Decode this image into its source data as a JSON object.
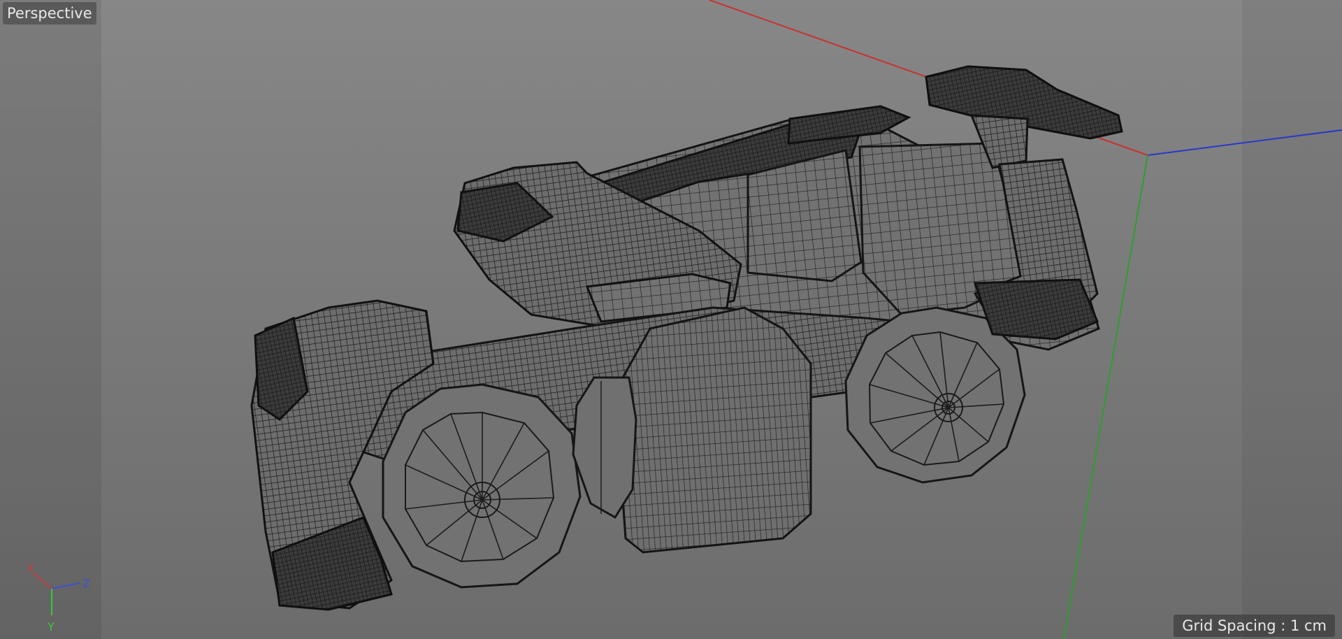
{
  "viewport": {
    "camera_label": "Perspective",
    "grid_spacing_label": "Grid Spacing : 1 cm"
  },
  "axis_gizmo": {
    "x_label": "X",
    "y_label": "Y",
    "z_label": "Z",
    "x_color": "#c83c3c",
    "y_color": "#3cc83c",
    "z_color": "#3c50d2"
  },
  "scene": {
    "object": "wireframe-vehicle-model",
    "world_axes_colors": {
      "x": "#c83232",
      "y": "#2e9e2e",
      "z": "#2838c8"
    }
  }
}
